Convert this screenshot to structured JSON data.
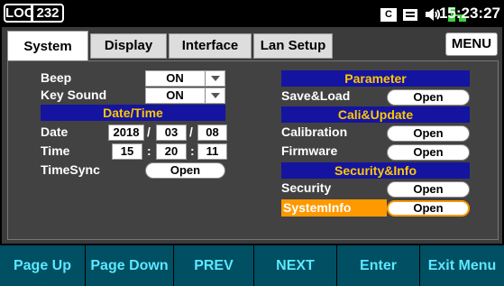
{
  "status": {
    "mode": "LOC",
    "address": "232",
    "cb_icon_label": "C",
    "time": "15:23:27"
  },
  "tabs": [
    "System",
    "Display",
    "Interface",
    "Lan Setup"
  ],
  "active_tab": "System",
  "menu_label": "MENU",
  "left": {
    "beep_label": "Beep",
    "beep_value": "ON",
    "keysound_label": "Key Sound",
    "keysound_value": "ON",
    "datetime_header": "Date/Time",
    "date_label": "Date",
    "date_year": "2018",
    "date_month": "03",
    "date_day": "08",
    "date_sep": "/",
    "time_label": "Time",
    "time_hour": "15",
    "time_min": "20",
    "time_sec": "11",
    "time_sep": ":",
    "timesync_label": "TimeSync",
    "timesync_btn": "Open"
  },
  "right": {
    "parameter_header": "Parameter",
    "saveload_label": "Save&Load",
    "saveload_btn": "Open",
    "cali_header": "Cali&Update",
    "calibration_label": "Calibration",
    "calibration_btn": "Open",
    "firmware_label": "Firmware",
    "firmware_btn": "Open",
    "security_header": "Security&Info",
    "security_label": "Security",
    "security_btn": "Open",
    "sysinfo_label": "SystemInfo",
    "sysinfo_btn": "Open"
  },
  "softkeys": [
    "Page Up",
    "Page Down",
    "PREV",
    "NEXT",
    "Enter",
    "Exit Menu"
  ],
  "colors": {
    "header_bg": "#1414a0",
    "header_text": "#ffc800",
    "highlight": "#ff9900",
    "softkey_bg": "#004f63",
    "softkey_text": "#5de8ff"
  }
}
